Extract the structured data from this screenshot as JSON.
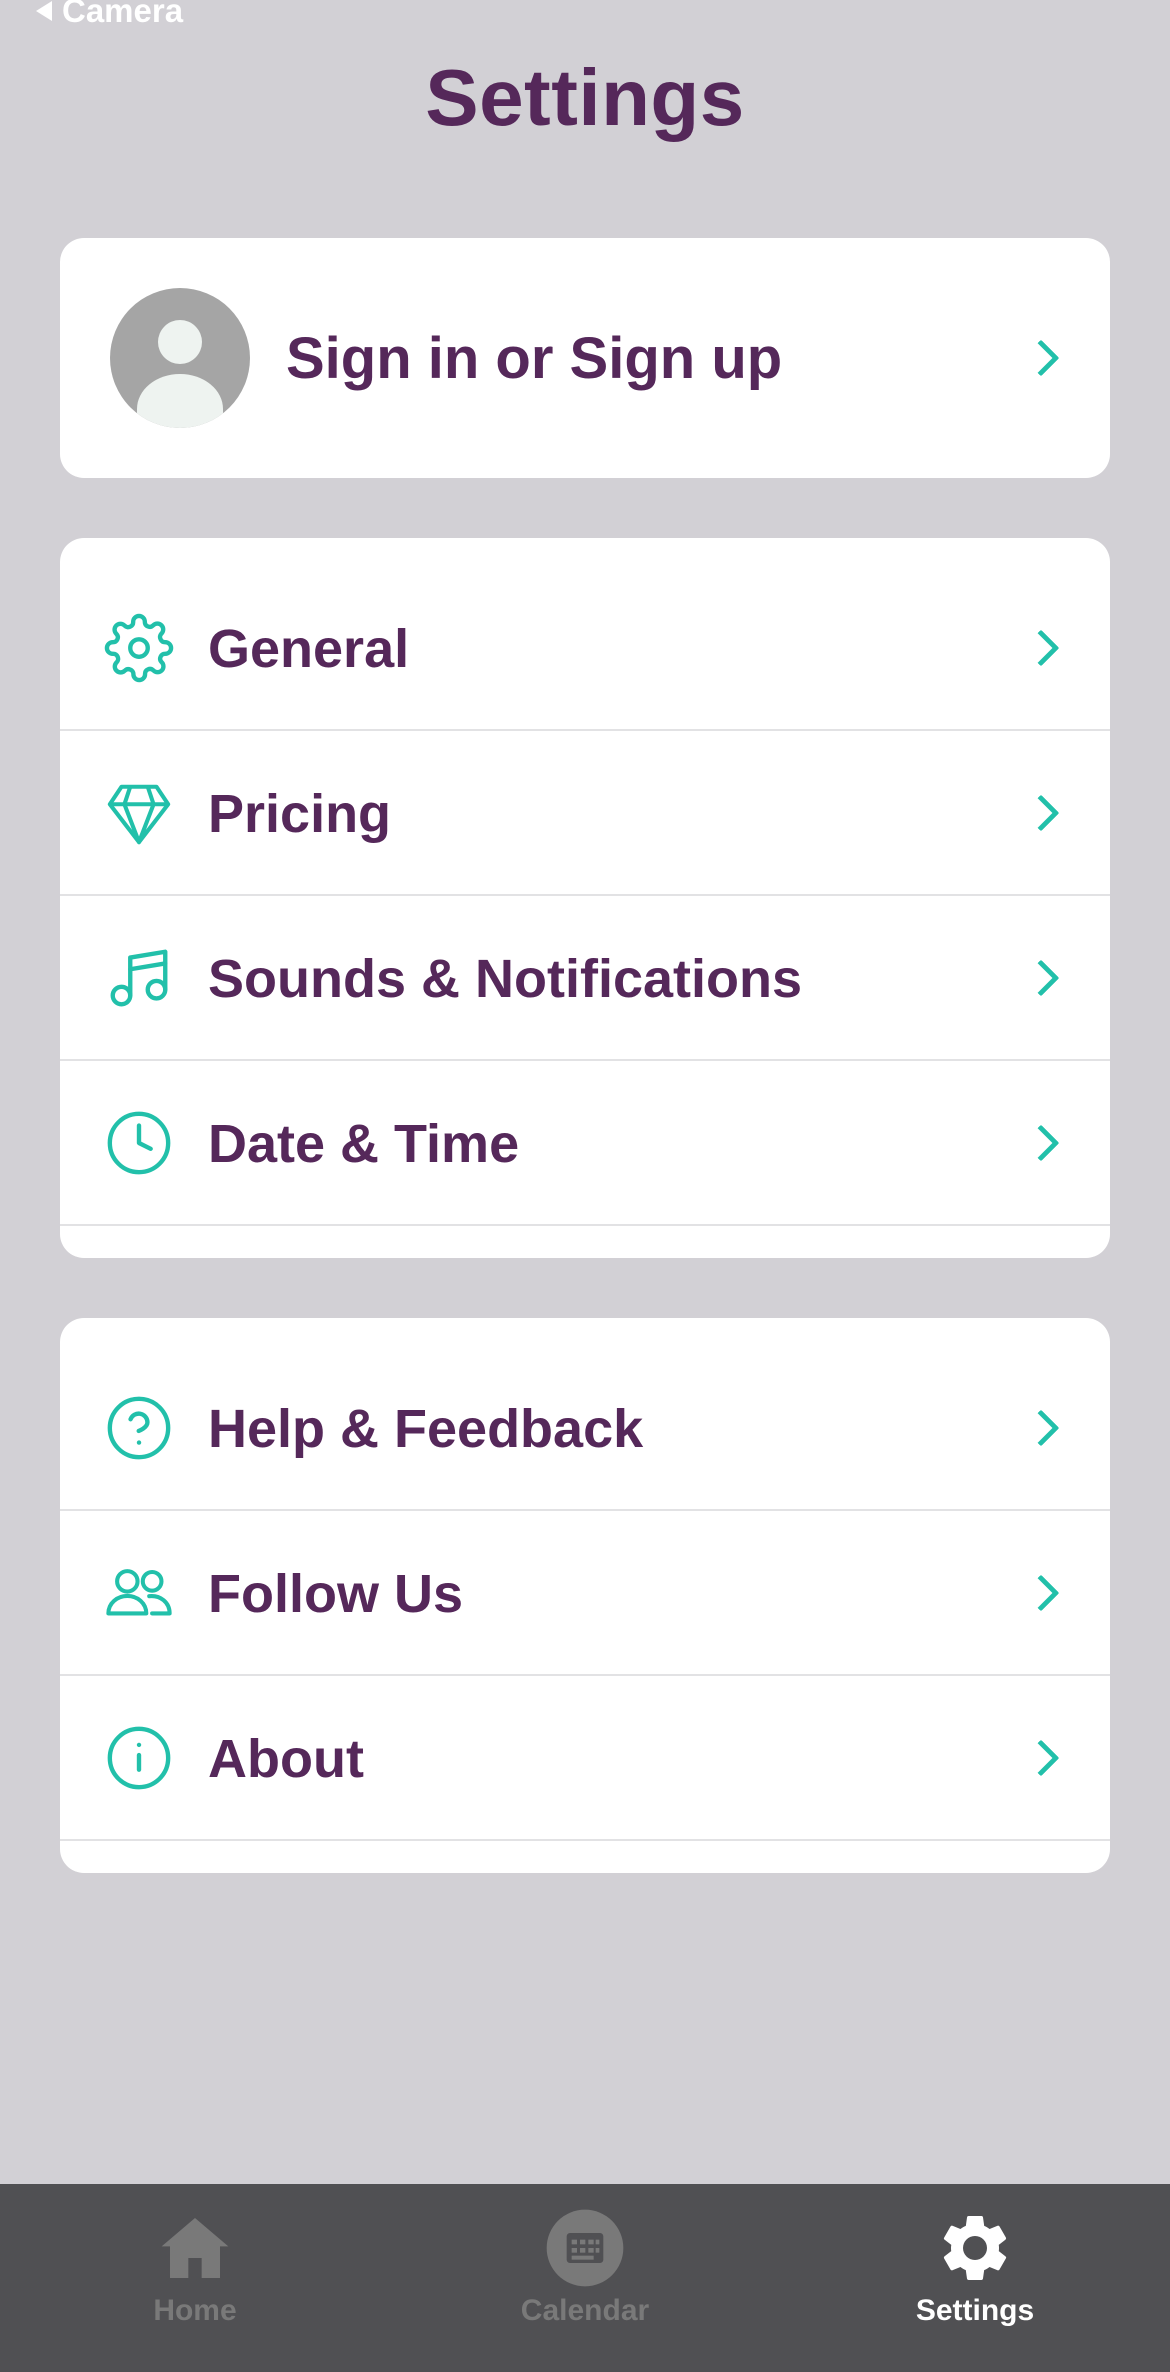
{
  "status_bar": {
    "back_label": "Camera"
  },
  "header": {
    "title": "Settings"
  },
  "profile": {
    "label": "Sign in or Sign up"
  },
  "settings_group": {
    "items": [
      {
        "label": "General",
        "icon": "gear-icon"
      },
      {
        "label": "Pricing",
        "icon": "diamond-icon"
      },
      {
        "label": "Sounds & Notifications",
        "icon": "music-note-icon"
      },
      {
        "label": "Date & Time",
        "icon": "clock-icon"
      }
    ]
  },
  "support_group": {
    "items": [
      {
        "label": "Help & Feedback",
        "icon": "question-circle-icon"
      },
      {
        "label": "Follow Us",
        "icon": "users-icon"
      },
      {
        "label": "About",
        "icon": "info-circle-icon"
      }
    ]
  },
  "tab_bar": {
    "tabs": [
      {
        "label": "Home",
        "icon": "home-icon",
        "active": false
      },
      {
        "label": "Calendar",
        "icon": "calendar-icon",
        "active": false
      },
      {
        "label": "Settings",
        "icon": "gear-icon",
        "active": true
      }
    ]
  },
  "colors": {
    "accent": "#22c0aa",
    "text_primary": "#55285a",
    "background": "#d2d0d5",
    "tab_bar": "#505053"
  }
}
